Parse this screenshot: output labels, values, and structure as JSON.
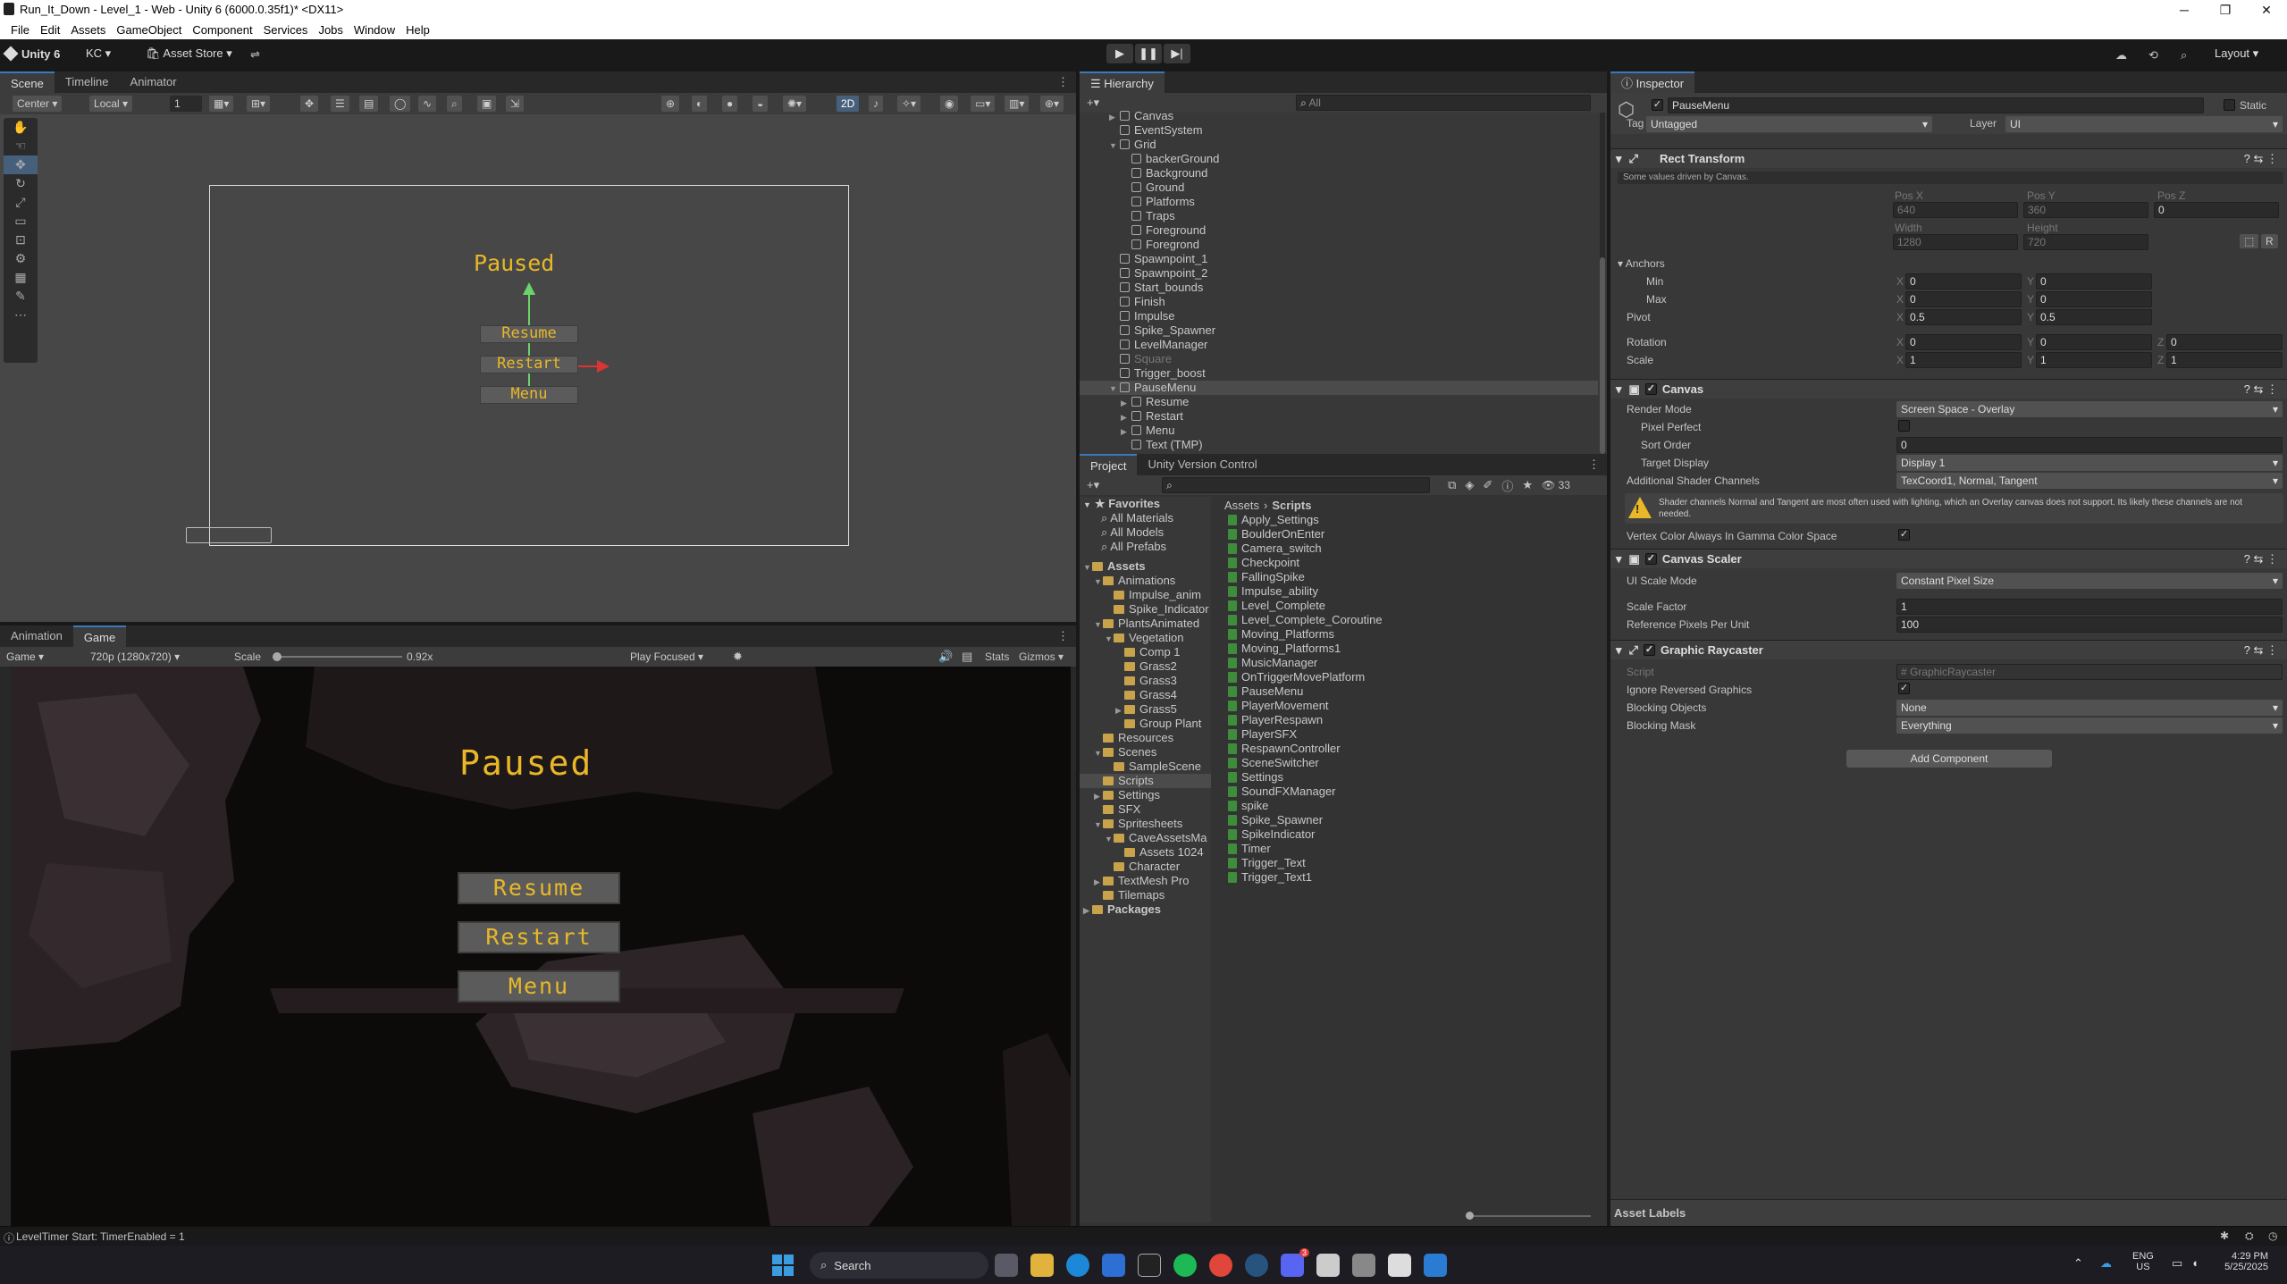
{
  "window": {
    "title": "Run_It_Down - Level_1 - Web - Unity 6 (6000.0.35f1)* <DX11>"
  },
  "menu": [
    "File",
    "Edit",
    "Assets",
    "GameObject",
    "Component",
    "Services",
    "Jobs",
    "Window",
    "Help"
  ],
  "toolbar": {
    "unity_label": "Unity 6",
    "account": "KC",
    "asset_store": "Asset Store",
    "layout": "Layout"
  },
  "scene_panel": {
    "tabs": [
      "Scene",
      "Timeline",
      "Animator"
    ],
    "pivot": "Center",
    "space": "Local",
    "snap": "1",
    "mode2d": "2D",
    "canvas": {
      "title": "Paused",
      "buttons": [
        "Resume",
        "Restart",
        "Menu"
      ]
    }
  },
  "game_panel": {
    "tabs": [
      "Animation",
      "Game"
    ],
    "display": "Game",
    "resolution": "720p (1280x720)",
    "scale_label": "Scale",
    "scale_value": "0.92x",
    "scale_fraction": 0.0,
    "play_mode": "Play Focused",
    "stats": "Stats",
    "gizmos": "Gizmos",
    "title": "Paused",
    "buttons": [
      "Resume",
      "Restart",
      "Menu"
    ]
  },
  "hierarchy": {
    "tab": "Hierarchy",
    "search_placeholder": "All",
    "items": [
      {
        "label": "Canvas",
        "depth": 1,
        "arrow": "▶"
      },
      {
        "label": "EventSystem",
        "depth": 1,
        "arrow": ""
      },
      {
        "label": "Grid",
        "depth": 1,
        "arrow": "▼"
      },
      {
        "label": "backerGround",
        "depth": 2,
        "arrow": ""
      },
      {
        "label": "Background",
        "depth": 2,
        "arrow": ""
      },
      {
        "label": "Ground",
        "depth": 2,
        "arrow": ""
      },
      {
        "label": "Platforms",
        "depth": 2,
        "arrow": ""
      },
      {
        "label": "Traps",
        "depth": 2,
        "arrow": ""
      },
      {
        "label": "Foreground",
        "depth": 2,
        "arrow": ""
      },
      {
        "label": "Foregrond",
        "depth": 2,
        "arrow": ""
      },
      {
        "label": "Spawnpoint_1",
        "depth": 1,
        "arrow": ""
      },
      {
        "label": "Spawnpoint_2",
        "depth": 1,
        "arrow": ""
      },
      {
        "label": "Start_bounds",
        "depth": 1,
        "arrow": ""
      },
      {
        "label": "Finish",
        "depth": 1,
        "arrow": ""
      },
      {
        "label": "Impulse",
        "depth": 1,
        "arrow": ""
      },
      {
        "label": "Spike_Spawner",
        "depth": 1,
        "arrow": ""
      },
      {
        "label": "LevelManager",
        "depth": 1,
        "arrow": ""
      },
      {
        "label": "Square",
        "depth": 1,
        "arrow": "",
        "dim": true
      },
      {
        "label": "Trigger_boost",
        "depth": 1,
        "arrow": ""
      },
      {
        "label": "PauseMenu",
        "depth": 1,
        "arrow": "▼",
        "selected": true
      },
      {
        "label": "Resume",
        "depth": 2,
        "arrow": "▶"
      },
      {
        "label": "Restart",
        "depth": 2,
        "arrow": "▶"
      },
      {
        "label": "Menu",
        "depth": 2,
        "arrow": "▶"
      },
      {
        "label": "Text (TMP)",
        "depth": 2,
        "arrow": ""
      }
    ]
  },
  "project": {
    "tabs": [
      "Project",
      "Unity Version Control"
    ],
    "count": "33",
    "breadcrumb": [
      "Assets",
      "Scripts"
    ],
    "favorites": {
      "label": "Favorites",
      "items": [
        "All Materials",
        "All Models",
        "All Prefabs"
      ]
    },
    "tree": [
      {
        "label": "Assets",
        "depth": 0,
        "arrow": "▼",
        "bold": true
      },
      {
        "label": "Animations",
        "depth": 1,
        "arrow": "▼"
      },
      {
        "label": "Impulse_anim",
        "depth": 2,
        "arrow": ""
      },
      {
        "label": "Spike_Indicator",
        "depth": 2,
        "arrow": ""
      },
      {
        "label": "PlantsAnimated",
        "depth": 1,
        "arrow": "▼"
      },
      {
        "label": "Vegetation",
        "depth": 2,
        "arrow": "▼"
      },
      {
        "label": "Comp 1",
        "depth": 3,
        "arrow": ""
      },
      {
        "label": "Grass2",
        "depth": 3,
        "arrow": ""
      },
      {
        "label": "Grass3",
        "depth": 3,
        "arrow": ""
      },
      {
        "label": "Grass4",
        "depth": 3,
        "arrow": ""
      },
      {
        "label": "Grass5",
        "depth": 3,
        "arrow": "▶"
      },
      {
        "label": "Group Plant",
        "depth": 3,
        "arrow": ""
      },
      {
        "label": "Resources",
        "depth": 1,
        "arrow": ""
      },
      {
        "label": "Scenes",
        "depth": 1,
        "arrow": "▼"
      },
      {
        "label": "SampleScene",
        "depth": 2,
        "arrow": ""
      },
      {
        "label": "Scripts",
        "depth": 1,
        "arrow": "",
        "selected": true
      },
      {
        "label": "Settings",
        "depth": 1,
        "arrow": "▶"
      },
      {
        "label": "SFX",
        "depth": 1,
        "arrow": ""
      },
      {
        "label": "Spritesheets",
        "depth": 1,
        "arrow": "▼"
      },
      {
        "label": "CaveAssetsMa",
        "depth": 2,
        "arrow": "▼"
      },
      {
        "label": "Assets 1024",
        "depth": 3,
        "arrow": ""
      },
      {
        "label": "Character",
        "depth": 2,
        "arrow": ""
      },
      {
        "label": "TextMesh Pro",
        "depth": 1,
        "arrow": "▶"
      },
      {
        "label": "Tilemaps",
        "depth": 1,
        "arrow": ""
      },
      {
        "label": "Packages",
        "depth": 0,
        "arrow": "▶",
        "bold": true
      }
    ],
    "scripts": [
      "Apply_Settings",
      "BoulderOnEnter",
      "Camera_switch",
      "Checkpoint",
      "FallingSpike",
      "Impulse_ability",
      "Level_Complete",
      "Level_Complete_Coroutine",
      "Moving_Platforms",
      "Moving_Platforms1",
      "MusicManager",
      "OnTriggerMovePlatform",
      "PauseMenu",
      "PlayerMovement",
      "PlayerRespawn",
      "PlayerSFX",
      "RespawnController",
      "SceneSwitcher",
      "Settings",
      "SoundFXManager",
      "spike",
      "Spike_Spawner",
      "SpikeIndicator",
      "Timer",
      "Trigger_Text",
      "Trigger_Text1"
    ]
  },
  "inspector": {
    "tab": "Inspector",
    "object_name": "PauseMenu",
    "static_label": "Static",
    "tag_label": "Tag",
    "tag_value": "Untagged",
    "layer_label": "Layer",
    "layer_value": "UI",
    "rect": {
      "title": "Rect Transform",
      "note": "Some values driven by Canvas.",
      "pos_x_label": "Pos X",
      "pos_y_label": "Pos Y",
      "pos_z_label": "Pos Z",
      "pos_x": "640",
      "pos_y": "360",
      "pos_z": "0",
      "width_label": "Width",
      "height_label": "Height",
      "width": "1280",
      "height": "720",
      "anchors": "Anchors",
      "min": "Min",
      "max": "Max",
      "min_x": "0",
      "min_y": "0",
      "max_x": "0",
      "max_y": "0",
      "pivot": "Pivot",
      "pivot_x": "0.5",
      "pivot_y": "0.5",
      "rotation": "Rotation",
      "rot_x": "0",
      "rot_y": "0",
      "rot_z": "0",
      "scale": "Scale",
      "scale_x": "1",
      "scale_y": "1",
      "scale_z": "1",
      "ax": "X",
      "ay": "Y",
      "az": "Z",
      "r_btn": "R"
    },
    "canvas": {
      "title": "Canvas",
      "render_mode_label": "Render Mode",
      "render_mode": "Screen Space - Overlay",
      "pixel_perfect": "Pixel Perfect",
      "sort_order_label": "Sort Order",
      "sort_order": "0",
      "target_display_label": "Target Display",
      "target_display": "Display 1",
      "shader_channels_label": "Additional Shader Channels",
      "shader_channels": "TexCoord1, Normal, Tangent",
      "warning": "Shader channels Normal and Tangent are most often used with lighting, which an Overlay canvas does not support. Its likely these channels are not needed.",
      "vertex_color": "Vertex Color Always In Gamma Color Space"
    },
    "scaler": {
      "title": "Canvas Scaler",
      "ui_scale_mode_label": "UI Scale Mode",
      "ui_scale_mode": "Constant Pixel Size",
      "scale_factor_label": "Scale Factor",
      "scale_factor": "1",
      "ref_ppu_label": "Reference Pixels Per Unit",
      "ref_ppu": "100"
    },
    "raycaster": {
      "title": "Graphic Raycaster",
      "script_label": "Script",
      "script_value": "GraphicRaycaster",
      "ignore_reversed": "Ignore Reversed Graphics",
      "blocking_objects_label": "Blocking Objects",
      "blocking_objects": "None",
      "blocking_mask_label": "Blocking Mask",
      "blocking_mask": "Everything"
    },
    "add_component": "Add Component",
    "asset_labels": "Asset Labels"
  },
  "statusbar": {
    "message": "LevelTimer Start: TimerEnabled = 1"
  },
  "taskbar": {
    "search": "Search",
    "lang1": "ENG",
    "lang2": "US",
    "time": "4:29 PM",
    "date": "5/25/2025",
    "badge": "3"
  },
  "colors": {
    "accent": "#3a79bb",
    "game_text": "#e8b828",
    "selection": "#2c5d87",
    "warning": "#e8b828"
  }
}
